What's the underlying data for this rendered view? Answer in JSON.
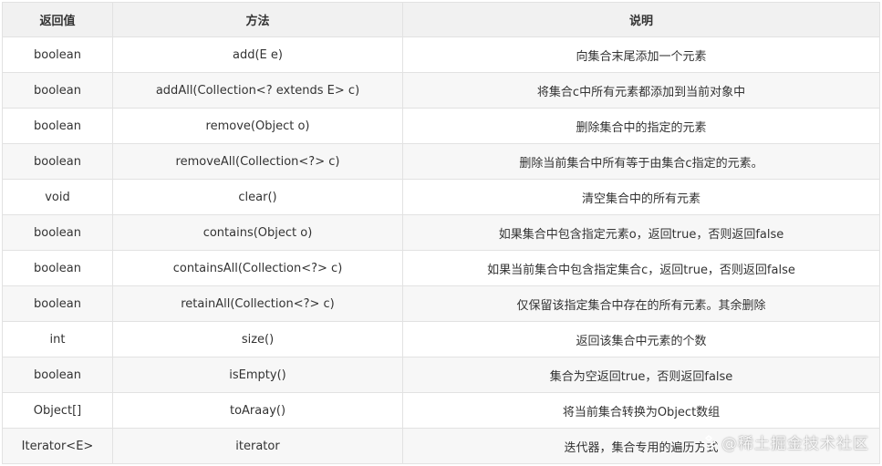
{
  "table": {
    "headers": [
      "返回值",
      "方法",
      "说明"
    ],
    "rows": [
      [
        "boolean",
        "add(E e)",
        "向集合末尾添加一个元素"
      ],
      [
        "boolean",
        "addAll(Collection<? extends E> c)",
        "将集合c中所有元素都添加到当前对象中"
      ],
      [
        "boolean",
        "remove(Object o)",
        "删除集合中的指定的元素"
      ],
      [
        "boolean",
        "removeAll(Collection<?> c)",
        "删除当前集合中所有等于由集合c指定的元素。"
      ],
      [
        "void",
        "clear()",
        "清空集合中的所有元素"
      ],
      [
        "boolean",
        "contains(Object o)",
        "如果集合中包含指定元素o，返回true，否则返回false"
      ],
      [
        "boolean",
        "containsAll(Collection<?> c)",
        "如果当前集合中包含指定集合c，返回true，否则返回false"
      ],
      [
        "boolean",
        "retainAll(Collection<?> c)",
        "仅保留该指定集合中存在的所有元素。其余删除"
      ],
      [
        "int",
        "size()",
        "返回该集合中元素的个数"
      ],
      [
        "boolean",
        "isEmpty()",
        "集合为空返回true，否则返回false"
      ],
      [
        "Object[]",
        "toAraay()",
        "将当前集合转换为Object数组"
      ],
      [
        "Iterator<E>",
        "iterator",
        "迭代器，集合专用的遍历方式"
      ]
    ]
  },
  "watermark": {
    "text": "@稀土掘金技术社区",
    "icon": "juejin-logo-icon"
  }
}
